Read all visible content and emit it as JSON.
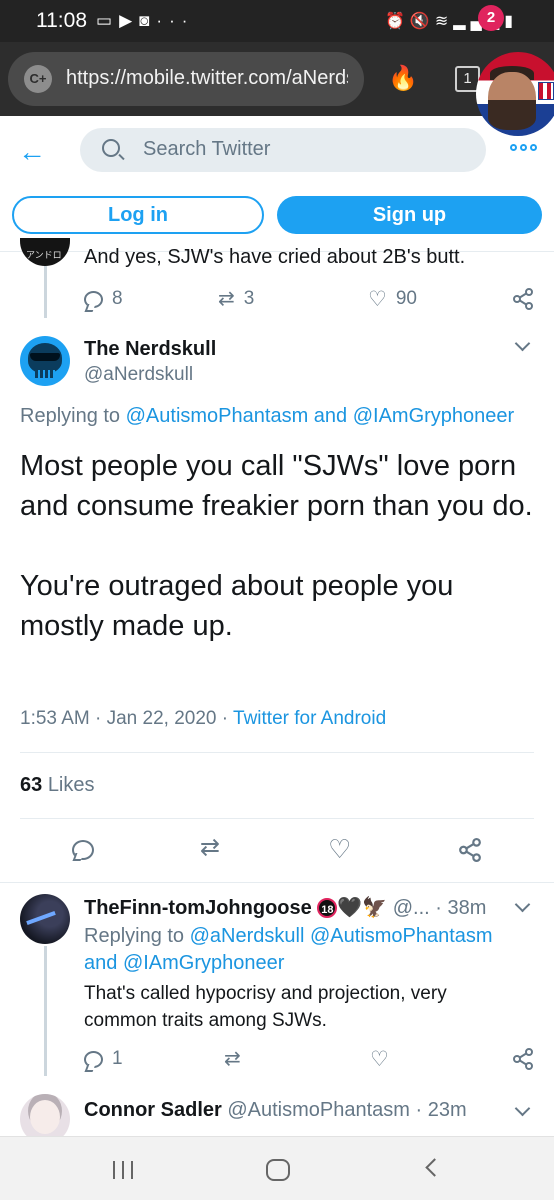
{
  "status_bar": {
    "time": "11:08",
    "left_icons": [
      "notification-icon",
      "youtube-icon",
      "discord-icon"
    ],
    "more": "···",
    "right_icons": [
      "alarm-icon",
      "mute-icon",
      "wifi-icon",
      "signal-icon",
      "battery-icon"
    ]
  },
  "browser": {
    "url": "https://mobile.twitter.com/aNerdskull",
    "tab_count": "1",
    "notification_count": "2"
  },
  "header": {
    "search_placeholder": "Search Twitter",
    "login_label": "Log in",
    "signup_label": "Sign up"
  },
  "prev_tweet": {
    "text": "And yes, SJW's have cried about 2B's butt.",
    "replies": "8",
    "retweets": "3",
    "likes": "90"
  },
  "main_tweet": {
    "name": "The Nerdskull",
    "handle": "@aNerdskull",
    "replying_prefix": "Replying to",
    "replying_to_1": "@AutismoPhantasm",
    "replying_and": "and",
    "replying_to_2": "@IAmGryphoneer",
    "text": "Most people you call \"SJWs\" love porn and consume freakier porn than you do.\n\nYou're outraged about people you mostly made up.",
    "time": "1:53 AM",
    "date": "Jan 22, 2020",
    "sep": "·",
    "source": "Twitter for Android",
    "likes_count": "63",
    "likes_label": "Likes"
  },
  "replies": [
    {
      "name": "TheFinn-tomJohngoose",
      "emoji": "🖤🦅",
      "badge": "18",
      "handle": "@...",
      "sep": "·",
      "time": "38m",
      "replying_prefix": "Replying to",
      "mention_1": "@aNerdskull",
      "mention_2": "@AutismoPhantasm",
      "and": "and",
      "mention_3": "@IAmGryphoneer",
      "text": "That's called hypocrisy and projection, very common traits among SJWs.",
      "reply_count": "1"
    },
    {
      "name": "Connor Sadler",
      "handle": "@AutismoPhantasm",
      "sep": "·",
      "time": "23m"
    }
  ],
  "colors": {
    "twitter_blue": "#1da1f2",
    "link_blue": "#1b95e0",
    "text": "#14171a",
    "secondary": "#657786",
    "status_bar": "#232323",
    "browser_bar": "#2d2d2d"
  }
}
